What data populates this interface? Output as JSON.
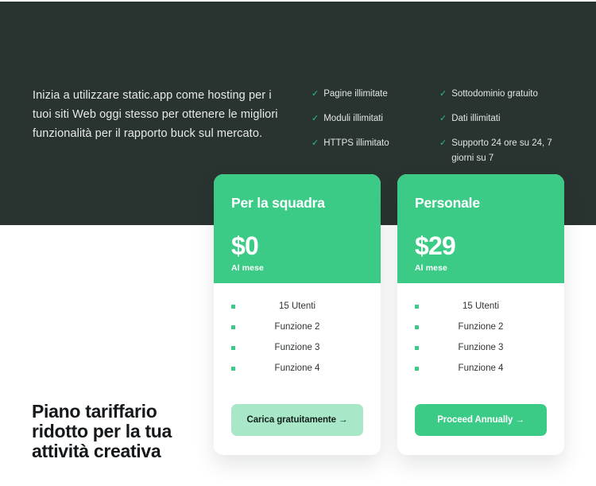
{
  "theme": {
    "dark_bg": "#293330",
    "accent": "#3ccb87",
    "accent_soft": "#a8e8c8",
    "page_bg": "#ffffff",
    "heading_color": "#15181a"
  },
  "hero": {
    "intro_paragraph": "Inizia a utilizzare static.app come hosting per i tuoi siti Web oggi stesso per ottenere le migliori funzionalità per il rapporto buck sul mercato.",
    "check_icon": "check-icon",
    "feature_columns": [
      {
        "items": [
          "Pagine illimitate",
          "Moduli illimitati",
          "HTTPS illimitato"
        ]
      },
      {
        "items": [
          "Sottodominio gratuito",
          "Dati illimitati",
          "Supporto 24 ore su 24, 7 giorni su 7"
        ]
      }
    ]
  },
  "pricing_heading": "Piano tariffario ridotto per la tua attività creativa",
  "plans": [
    {
      "title": "Per la squadra",
      "price": "$0",
      "period": "Al mese",
      "features": [
        "15 Utenti",
        "Funzione 2",
        "Funzione 3",
        "Funzione 4"
      ],
      "cta_label": "Carica gratuitamente →",
      "cta_style": "soft"
    },
    {
      "title": "Personale",
      "price": "$29",
      "period": "Al mese",
      "features": [
        "15 Utenti",
        "Funzione 2",
        "Funzione 3",
        "Funzione 4"
      ],
      "cta_label": "Proceed Annually →",
      "cta_style": "solid"
    }
  ]
}
